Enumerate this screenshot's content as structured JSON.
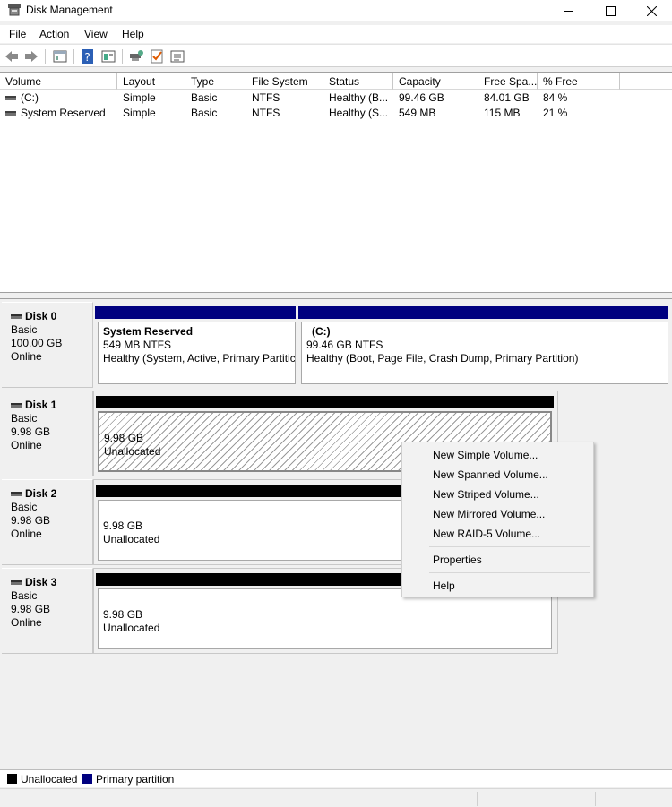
{
  "window": {
    "title": "Disk Management",
    "minimize_icon": "minimize-icon",
    "maximize_icon": "maximize-icon",
    "close_icon": "close-icon"
  },
  "menu": [
    "File",
    "Action",
    "View",
    "Help"
  ],
  "toolbar": [
    "back-icon",
    "forward-icon",
    "console-tree-icon",
    "help-icon",
    "properties-icon",
    "connect-icon",
    "checklist-icon",
    "list-view-icon"
  ],
  "columns": [
    "Volume",
    "Layout",
    "Type",
    "File System",
    "Status",
    "Capacity",
    "Free Spa...",
    "% Free"
  ],
  "volumes": [
    {
      "volume": "(C:)",
      "layout": "Simple",
      "type": "Basic",
      "fs": "NTFS",
      "status": "Healthy (B...",
      "capacity": "99.46 GB",
      "free": "84.01 GB",
      "pct": "84 %"
    },
    {
      "volume": "System Reserved",
      "layout": "Simple",
      "type": "Basic",
      "fs": "NTFS",
      "status": "Healthy (S...",
      "capacity": "549 MB",
      "free": "115 MB",
      "pct": "21 %"
    }
  ],
  "disks": [
    {
      "name": "Disk 0",
      "type": "Basic",
      "size": "100.00 GB",
      "state": "Online",
      "partitions": [
        {
          "title": "System Reserved",
          "size": "549 MB NTFS",
          "status": "Healthy (System, Active, Primary Partitic"
        },
        {
          "title": "(C:)",
          "size": "99.46 GB NTFS",
          "status": "Healthy (Boot, Page File, Crash Dump, Primary Partition)"
        }
      ]
    },
    {
      "name": "Disk 1",
      "type": "Basic",
      "size": "9.98 GB",
      "state": "Online",
      "unalloc_size": "9.98 GB",
      "unalloc_label": "Unallocated"
    },
    {
      "name": "Disk 2",
      "type": "Basic",
      "size": "9.98 GB",
      "state": "Online",
      "unalloc_size": "9.98 GB",
      "unalloc_label": "Unallocated"
    },
    {
      "name": "Disk 3",
      "type": "Basic",
      "size": "9.98 GB",
      "state": "Online",
      "unalloc_size": "9.98 GB",
      "unalloc_label": "Unallocated"
    }
  ],
  "context_menu": {
    "items": [
      "New Simple Volume...",
      "New Spanned Volume...",
      "New Striped Volume...",
      "New Mirrored Volume...",
      "New RAID-5 Volume..."
    ],
    "properties": "Properties",
    "help": "Help"
  },
  "legend": {
    "unallocated": "Unallocated",
    "unallocated_color": "#000000",
    "primary": "Primary partition",
    "primary_color": "#00007f"
  }
}
